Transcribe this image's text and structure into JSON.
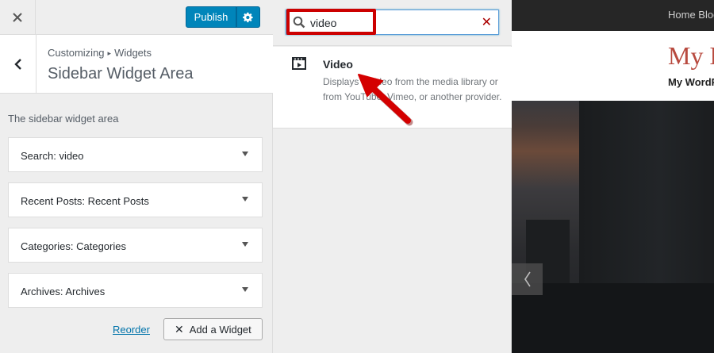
{
  "topbar": {
    "close_icon": "close-icon",
    "publish_label": "Publish",
    "settings_icon": "gear-icon",
    "accent_color": "#0085ba"
  },
  "section_header": {
    "breadcrumb_root": "Customizing",
    "breadcrumb_separator": "▸",
    "breadcrumb_current": "Widgets",
    "title": "Sidebar Widget Area",
    "back_icon": "chevron-left-icon"
  },
  "sidebar": {
    "description": "The sidebar widget area",
    "widgets": [
      {
        "type": "Search:",
        "name": "video"
      },
      {
        "type": "Recent Posts:",
        "name": "Recent Posts"
      },
      {
        "type": "Categories:",
        "name": "Categories"
      },
      {
        "type": "Archives:",
        "name": "Archives"
      }
    ],
    "reorder_label": "Reorder",
    "add_widget_label": "Add a Widget"
  },
  "available_widgets": {
    "search_value": "video",
    "search_icon": "search-icon",
    "clear_icon": "clear-icon",
    "results": [
      {
        "title": "Video",
        "icon": "video-icon",
        "description": "Displays a video from the media library or from YouTube, Vimeo, or another provider."
      }
    ]
  },
  "preview": {
    "nav_text": "Home Blog",
    "site_title": "My Blog",
    "site_tagline": "My WordPress Blog",
    "prev_icon": "chevron-left-icon"
  },
  "annotations": {
    "highlight_color": "#cc0000"
  }
}
